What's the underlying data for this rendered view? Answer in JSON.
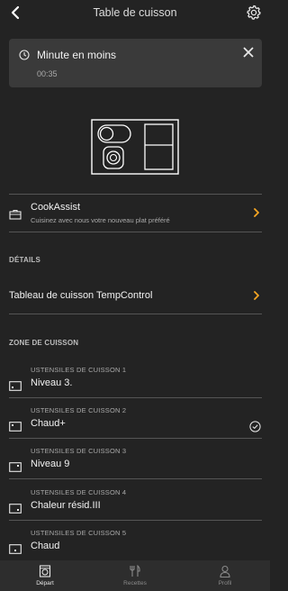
{
  "header": {
    "title": "Table de cuisson",
    "back_icon": "back-arrow-icon",
    "settings_icon": "gear-icon"
  },
  "timer": {
    "title": "Minute en moins",
    "value": "00:35",
    "icon": "clock-icon",
    "close_icon": "close-icon"
  },
  "cookassist": {
    "title": "CookAssist",
    "subtitle": "Cuisinez avec nous votre nouveau plat préféré",
    "icon": "briefcase-icon"
  },
  "details": {
    "heading": "DÉTAILS",
    "item_label": "Tableau de cuisson TempControl"
  },
  "zones": {
    "heading": "ZONE DE CUISSON",
    "items": [
      {
        "label": "USTENSILES DE CUISSON 1",
        "value": "Niveau 3.",
        "checked": false
      },
      {
        "label": "USTENSILES DE CUISSON 2",
        "value": "Chaud+",
        "checked": true
      },
      {
        "label": "USTENSILES DE CUISSON 3",
        "value": "Niveau 9",
        "checked": false
      },
      {
        "label": "USTENSILES DE CUISSON 4",
        "value": "Chaleur résid.III",
        "checked": false
      },
      {
        "label": "USTENSILES DE CUISSON 5",
        "value": "Chaud",
        "checked": false
      }
    ]
  },
  "tabbar": {
    "tabs": [
      {
        "label": "Départ",
        "icon": "oven-icon",
        "active": true
      },
      {
        "label": "Recettes",
        "icon": "utensils-icon",
        "active": false
      },
      {
        "label": "Profil",
        "icon": "user-icon",
        "active": false
      }
    ]
  },
  "colors": {
    "background": "#232323",
    "card": "#3a3a3a",
    "accent": "#f5a623",
    "text": "#f2f2f2",
    "muted": "#aaaaaa"
  }
}
